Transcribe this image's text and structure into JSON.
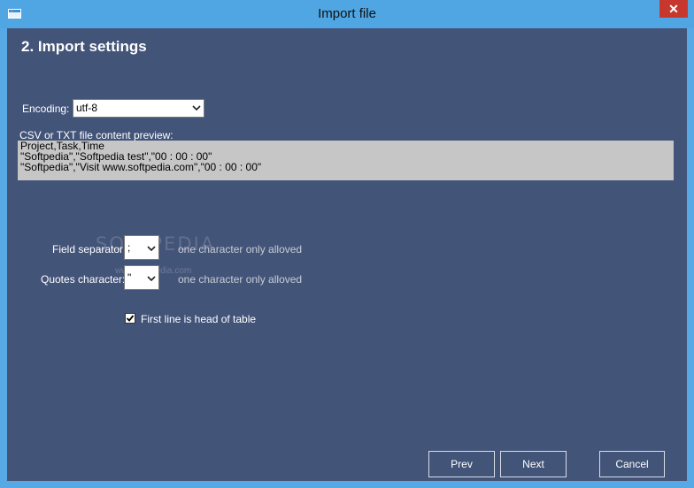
{
  "window": {
    "title": "Import file",
    "close_glyph": "✕",
    "icon": "app-window-icon"
  },
  "main": {
    "heading": "2. Import settings",
    "encoding": {
      "label": "Encoding:",
      "value": "utf-8"
    },
    "preview": {
      "label": "CSV or TXT file content preview:",
      "lines": [
        "Project,Task,Time",
        "\"Softpedia\",\"Softpedia test\",\"00 : 00 : 00\"",
        "\"Softpedia\",\"Visit www.softpedia.com\",\"00 : 00 : 00\""
      ]
    },
    "field_separator": {
      "label": "Field separator:",
      "value": ";",
      "hint": "one character only alloved"
    },
    "quotes_character": {
      "label": "Quotes character:",
      "value": "\"",
      "hint": "one character only alloved"
    },
    "first_line_head": {
      "label": "First line is head of table",
      "checked": true
    }
  },
  "watermark": {
    "text": "SOFTPEDIA",
    "url": "www.softpedia.com"
  },
  "buttons": {
    "prev": "Prev",
    "next": "Next",
    "cancel": "Cancel"
  },
  "colors": {
    "titlebar": "#4fa6e3",
    "client": "#435479",
    "close": "#c7372e",
    "preview_bg": "#c6c6c6"
  }
}
